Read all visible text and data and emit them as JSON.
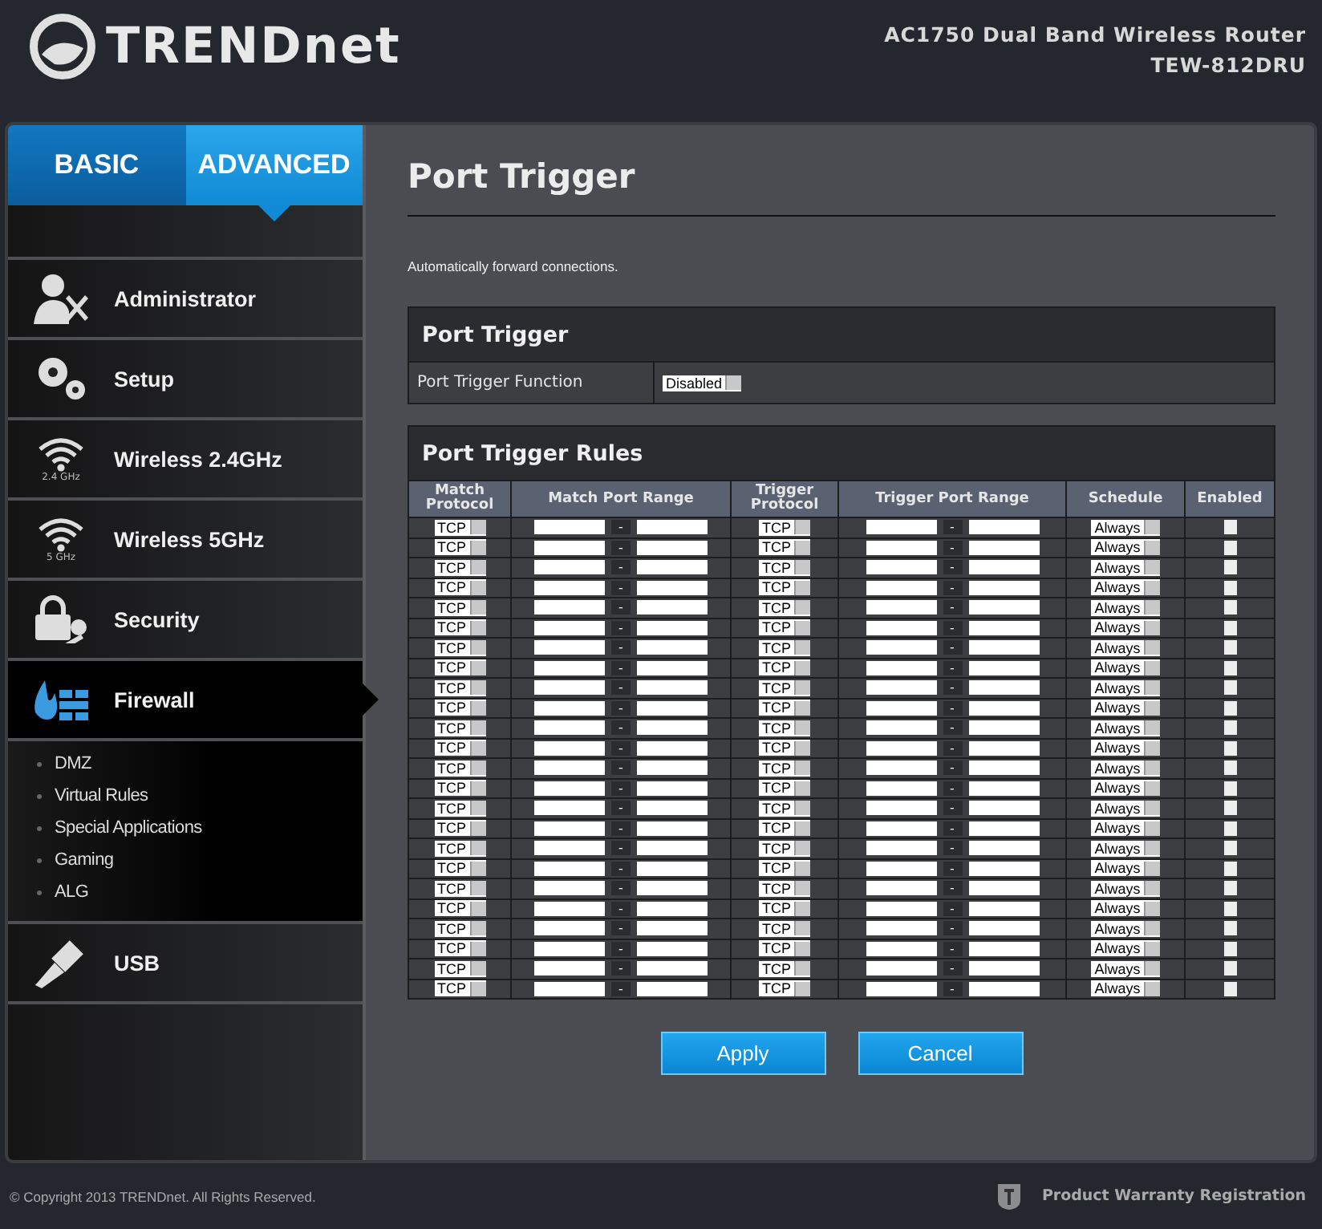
{
  "header": {
    "logo": "TRENDnet",
    "product": "AC1750 Dual Band Wireless Router",
    "model": "TEW-812DRU"
  },
  "mode_tabs": [
    {
      "label": "BASIC",
      "selected": false
    },
    {
      "label": "ADVANCED",
      "selected": true
    }
  ],
  "sidebar": {
    "items": [
      {
        "label": "Administrator",
        "selected": false
      },
      {
        "label": "Setup",
        "selected": false
      },
      {
        "label": "Wireless 2.4GHz",
        "icon_caption": "2.4 GHz",
        "selected": false
      },
      {
        "label": "Wireless 5GHz",
        "icon_caption": "5 GHz",
        "selected": false
      },
      {
        "label": "Security",
        "selected": false
      },
      {
        "label": "Firewall",
        "selected": true,
        "expanded": true,
        "children": [
          {
            "label": "DMZ"
          },
          {
            "label": "Virtual Rules"
          },
          {
            "label": "Special Applications"
          },
          {
            "label": "Gaming"
          },
          {
            "label": "ALG"
          }
        ]
      },
      {
        "label": "USB",
        "selected": false
      }
    ]
  },
  "content": {
    "title": "Port Trigger",
    "description": "Automatically forward connections.",
    "port_trigger": {
      "title": "Port Trigger",
      "function_label": "Port Trigger Function",
      "function_value": "Disabled"
    },
    "rules": {
      "title": "Port Trigger Rules",
      "columns": [
        "Match Protocol",
        "Match Port Range",
        "Trigger Protocol",
        "Trigger Port Range",
        "Schedule",
        "Enabled"
      ],
      "rows": [
        {
          "match_protocol": "TCP",
          "match_separator": "-",
          "trigger_protocol": "TCP",
          "trigger_separator": "-",
          "schedule": "Always",
          "enabled": false
        },
        {
          "match_protocol": "TCP",
          "match_separator": "-",
          "trigger_protocol": "TCP",
          "trigger_separator": "-",
          "schedule": "Always",
          "enabled": false
        },
        {
          "match_protocol": "TCP",
          "match_separator": "-",
          "trigger_protocol": "TCP",
          "trigger_separator": "-",
          "schedule": "Always",
          "enabled": false
        },
        {
          "match_protocol": "TCP",
          "match_separator": "-",
          "trigger_protocol": "TCP",
          "trigger_separator": "-",
          "schedule": "Always",
          "enabled": false
        },
        {
          "match_protocol": "TCP",
          "match_separator": "-",
          "trigger_protocol": "TCP",
          "trigger_separator": "-",
          "schedule": "Always",
          "enabled": false
        },
        {
          "match_protocol": "TCP",
          "match_separator": "-",
          "trigger_protocol": "TCP",
          "trigger_separator": "-",
          "schedule": "Always",
          "enabled": false
        },
        {
          "match_protocol": "TCP",
          "match_separator": "-",
          "trigger_protocol": "TCP",
          "trigger_separator": "-",
          "schedule": "Always",
          "enabled": false
        },
        {
          "match_protocol": "TCP",
          "match_separator": "-",
          "trigger_protocol": "TCP",
          "trigger_separator": "-",
          "schedule": "Always",
          "enabled": false
        },
        {
          "match_protocol": "TCP",
          "match_separator": "-",
          "trigger_protocol": "TCP",
          "trigger_separator": "-",
          "schedule": "Always",
          "enabled": false
        },
        {
          "match_protocol": "TCP",
          "match_separator": "-",
          "trigger_protocol": "TCP",
          "trigger_separator": "-",
          "schedule": "Always",
          "enabled": false
        },
        {
          "match_protocol": "TCP",
          "match_separator": "-",
          "trigger_protocol": "TCP",
          "trigger_separator": "-",
          "schedule": "Always",
          "enabled": false
        },
        {
          "match_protocol": "TCP",
          "match_separator": "-",
          "trigger_protocol": "TCP",
          "trigger_separator": "-",
          "schedule": "Always",
          "enabled": false
        },
        {
          "match_protocol": "TCP",
          "match_separator": "-",
          "trigger_protocol": "TCP",
          "trigger_separator": "-",
          "schedule": "Always",
          "enabled": false
        },
        {
          "match_protocol": "TCP",
          "match_separator": "-",
          "trigger_protocol": "TCP",
          "trigger_separator": "-",
          "schedule": "Always",
          "enabled": false
        },
        {
          "match_protocol": "TCP",
          "match_separator": "-",
          "trigger_protocol": "TCP",
          "trigger_separator": "-",
          "schedule": "Always",
          "enabled": false
        },
        {
          "match_protocol": "TCP",
          "match_separator": "-",
          "trigger_protocol": "TCP",
          "trigger_separator": "-",
          "schedule": "Always",
          "enabled": false
        },
        {
          "match_protocol": "TCP",
          "match_separator": "-",
          "trigger_protocol": "TCP",
          "trigger_separator": "-",
          "schedule": "Always",
          "enabled": false
        },
        {
          "match_protocol": "TCP",
          "match_separator": "-",
          "trigger_protocol": "TCP",
          "trigger_separator": "-",
          "schedule": "Always",
          "enabled": false
        },
        {
          "match_protocol": "TCP",
          "match_separator": "-",
          "trigger_protocol": "TCP",
          "trigger_separator": "-",
          "schedule": "Always",
          "enabled": false
        },
        {
          "match_protocol": "TCP",
          "match_separator": "-",
          "trigger_protocol": "TCP",
          "trigger_separator": "-",
          "schedule": "Always",
          "enabled": false
        },
        {
          "match_protocol": "TCP",
          "match_separator": "-",
          "trigger_protocol": "TCP",
          "trigger_separator": "-",
          "schedule": "Always",
          "enabled": false
        },
        {
          "match_protocol": "TCP",
          "match_separator": "-",
          "trigger_protocol": "TCP",
          "trigger_separator": "-",
          "schedule": "Always",
          "enabled": false
        },
        {
          "match_protocol": "TCP",
          "match_separator": "-",
          "trigger_protocol": "TCP",
          "trigger_separator": "-",
          "schedule": "Always",
          "enabled": false
        },
        {
          "match_protocol": "TCP",
          "match_separator": "-",
          "trigger_protocol": "TCP",
          "trigger_separator": "-",
          "schedule": "Always",
          "enabled": false
        }
      ]
    },
    "buttons": [
      "Apply",
      "Cancel"
    ]
  },
  "footer": {
    "copyright": "© Copyright 2013 TRENDnet. All Rights Reserved.",
    "warranty_link": "Product Warranty Registration"
  }
}
